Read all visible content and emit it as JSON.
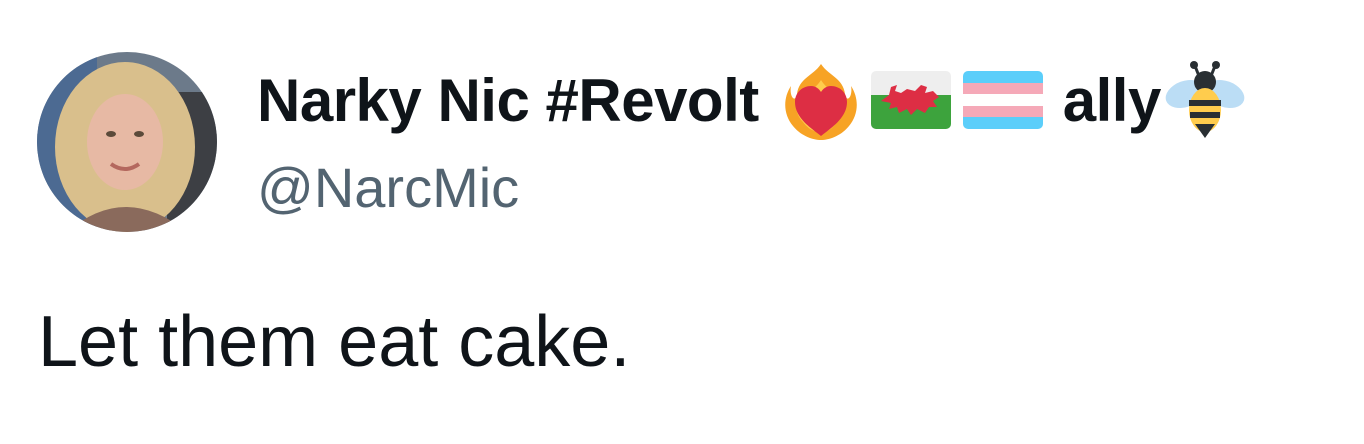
{
  "user": {
    "display_name": "Narky Nic #Revolt",
    "name_suffix": "ally",
    "handle": "@NarcMic",
    "emojis": [
      "heart-on-fire-icon",
      "wales-flag-icon",
      "transgender-flag-icon",
      "bee-icon"
    ]
  },
  "tweet": {
    "text": "Let them eat cake."
  },
  "colors": {
    "text_primary": "#0f1419",
    "text_secondary": "#536471",
    "background": "#ffffff"
  }
}
